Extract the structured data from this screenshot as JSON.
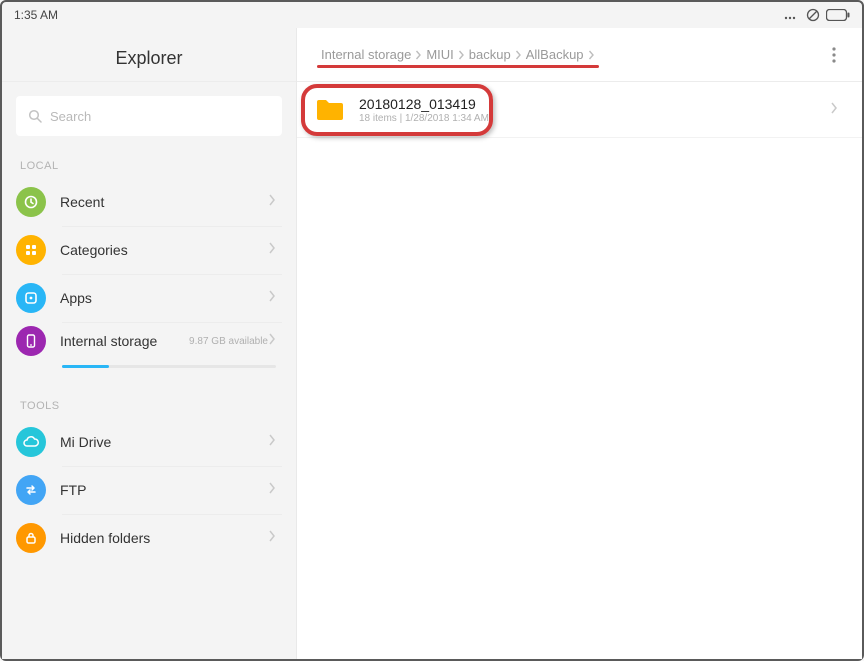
{
  "statusbar": {
    "time": "1:35  AM"
  },
  "sidebar": {
    "app_title": "Explorer",
    "search_placeholder": "Search",
    "section_local": "LOCAL",
    "section_tools": "TOOLS",
    "items_local": [
      {
        "label": "Recent"
      },
      {
        "label": "Categories"
      },
      {
        "label": "Apps"
      },
      {
        "label": "Internal storage",
        "sublabel": "9.87 GB available"
      }
    ],
    "items_tools": [
      {
        "label": "Mi Drive"
      },
      {
        "label": "FTP"
      },
      {
        "label": "Hidden folders"
      }
    ]
  },
  "breadcrumb": {
    "crumbs": [
      "Internal storage",
      "MIUI",
      "backup",
      "AllBackup"
    ]
  },
  "files": [
    {
      "name": "20180128_013419",
      "meta": "18 items  |  1/28/2018 1:34 AM"
    }
  ]
}
